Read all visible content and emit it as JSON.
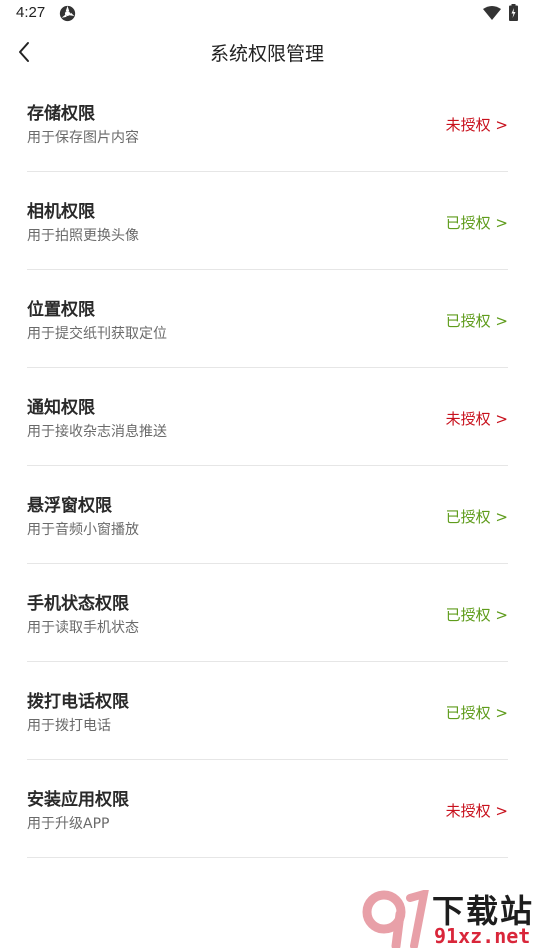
{
  "status_bar": {
    "time": "4:27"
  },
  "header": {
    "title": "系统权限管理"
  },
  "permissions": [
    {
      "title": "存储权限",
      "desc": "用于保存图片内容",
      "status": "未授权 >",
      "state": "unauthorized"
    },
    {
      "title": "相机权限",
      "desc": "用于拍照更换头像",
      "status": "已授权 >",
      "state": "authorized"
    },
    {
      "title": "位置权限",
      "desc": "用于提交纸刊获取定位",
      "status": "已授权 >",
      "state": "authorized"
    },
    {
      "title": "通知权限",
      "desc": "用于接收杂志消息推送",
      "status": "未授权 >",
      "state": "unauthorized"
    },
    {
      "title": "悬浮窗权限",
      "desc": "用于音频小窗播放",
      "status": "已授权 >",
      "state": "authorized"
    },
    {
      "title": "手机状态权限",
      "desc": "用于读取手机状态",
      "status": "已授权 >",
      "state": "authorized"
    },
    {
      "title": "拨打电话权限",
      "desc": "用于拨打电话",
      "status": "已授权 >",
      "state": "authorized"
    },
    {
      "title": "安装应用权限",
      "desc": "用于升级APP",
      "status": "未授权 >",
      "state": "unauthorized"
    }
  ],
  "colors": {
    "unauthorized": "#c8111d",
    "authorized": "#5f9c1c"
  },
  "watermark": {
    "brand": "下载站",
    "domain": "91xz.net"
  }
}
